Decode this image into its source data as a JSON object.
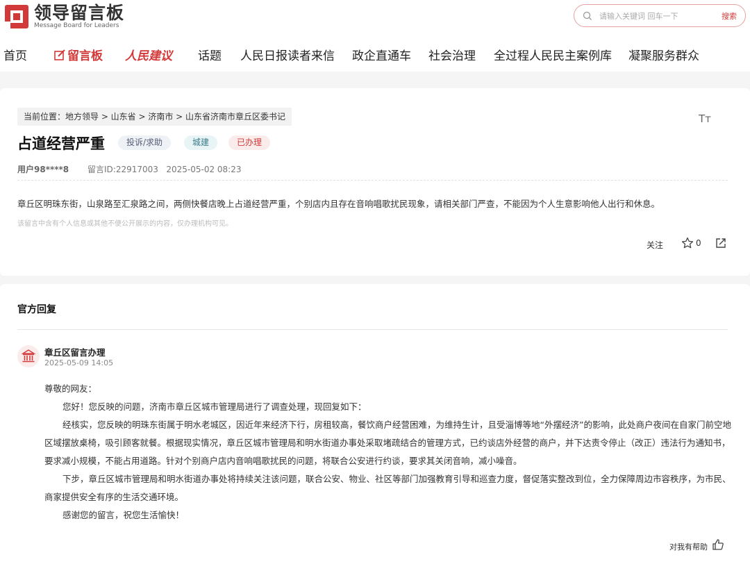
{
  "header": {
    "logo_title": "领导留言板",
    "logo_subtitle": "Message Board for Leaders",
    "search_placeholder": "请输入关键词 回车一下",
    "search_button": "搜索"
  },
  "nav": {
    "items": [
      {
        "label": "首页"
      },
      {
        "label": "留言板"
      },
      {
        "label": "人民建议"
      },
      {
        "label": "话题"
      },
      {
        "label": "人民日报读者来信"
      },
      {
        "label": "政企直通车"
      },
      {
        "label": "社会治理"
      },
      {
        "label": "全过程人民民主案例库"
      },
      {
        "label": "凝聚服务群众"
      }
    ]
  },
  "message": {
    "breadcrumb": "当前位置：地方领导 > 山东省 > 济南市 > 山东省济南市章丘区委书记",
    "font_toggle": "Tт",
    "title": "占道经营严重",
    "tags": [
      "投诉/求助",
      "城建",
      "已办理"
    ],
    "user": "用户98****8",
    "id_date": "留言ID:22917003   2025-05-02 08:23",
    "content": "章丘区明珠东街，山泉路至汇泉路之间，两侧快餐店晚上占道经营严重，个别店内且存在音响唱歌扰民现象，请相关部门严查，不能因为个人生意影响他人出行和休息。",
    "notice": "该留言中含有个人信息或其他不便公开展示的内容，仅办理机构可见。",
    "follow": "关注",
    "star_count": "0"
  },
  "reply": {
    "heading": "官方回复",
    "org": "章丘区留言办理",
    "date": "2025-05-09 14:05",
    "greeting": "尊敬的网友：",
    "p1": "您好！您反映的问题，济南市章丘区城市管理局进行了调查处理，现回复如下：",
    "p2": "经核实，您反映的明珠东街属于明水老城区，因近年来经济下行，房租较高，餐饮商户经营困难，为维持生计，且受淄博等地“外摆经济”的影响，此处商户夜间在自家门前空地区域摆放桌椅，吸引顾客就餐。根据现实情况，章丘区城市管理局和明水街道办事处采取堵疏结合的管理方式，已约谈店外经营的商户，并下达责令停止（改正）违法行为通知书，要求减小规模，不能占用道路。针对个别商户店内音响唱歌扰民的问题，将联合公安进行约谈，要求其关闭音响，减小噪音。",
    "p3": "下步，章丘区城市管理局和明水街道办事处将持续关注该问题，联合公安、物业、社区等部门加强教育引导和巡查力度，督促落实整改到位，全力保障周边市容秩序，为市民、商家提供安全有序的生活交通环境。",
    "p4": "感谢您的留言，祝您生活愉快！",
    "helpful": "对我有帮助"
  },
  "colors": {
    "accent": "#d23a3a"
  }
}
